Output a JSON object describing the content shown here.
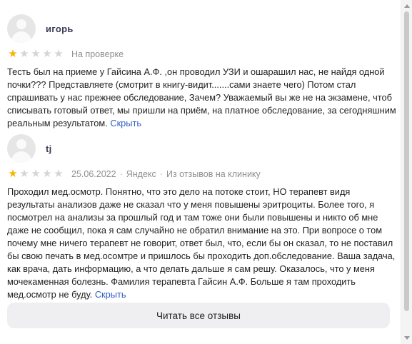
{
  "reviews": [
    {
      "author": "игорь",
      "rating": 1,
      "max_rating": 5,
      "status": "На проверке",
      "text": "Тесть был на приеме у Гайсина А.Ф. ,он проводил УЗИ и ошарашил нас, не найдя одной почки??? Представляете (смотрит в книгу-видит.......сами знаете чего) Потом стал спрашивать у нас прежнее обследование, Зачем? Уважаемый вы же не на экзамене, чтоб списывать готовый ответ, мы пришли на приём, на платное обследование, за сегодняшним реальным результатом.",
      "hide_label": "Скрыть"
    },
    {
      "author": "tj",
      "rating": 1,
      "max_rating": 5,
      "date": "25.06.2022",
      "source": "Яндекс",
      "origin": "Из отзывов на клинику",
      "text": "Проходил мед.осмотр. Понятно, что это дело на потоке стоит, НО терапевт видя результаты анализов даже не сказал что у меня повышены эритроциты. Более того, я посмотрел на анализы за прошлый год и там тоже они были повышены и никто об мне даже не сообщил, пока я сам случайно не обратил внимание на это. При вопросе о том почему мне ничего терапевт не говорит, ответ был, что, если бы он сказал, то не поставил бы свою печать в мед.осомтре и пришлось бы проходить доп.обследование. Ваша задача, как врача, дать информацию, а что делать дальше я сам решу. Оказалось, что у меня мочекаменная болезнь. Фамилия терапевта Гайсин А.Ф. Больше я там проходить мед.осмотр не буду.",
      "hide_label": "Скрыть"
    }
  ],
  "read_all_label": "Читать все отзывы",
  "colors": {
    "star_filled": "#f5b400",
    "star_empty": "#d5d5d5",
    "link": "#2f5fc4",
    "button_bg": "#efeff1"
  }
}
